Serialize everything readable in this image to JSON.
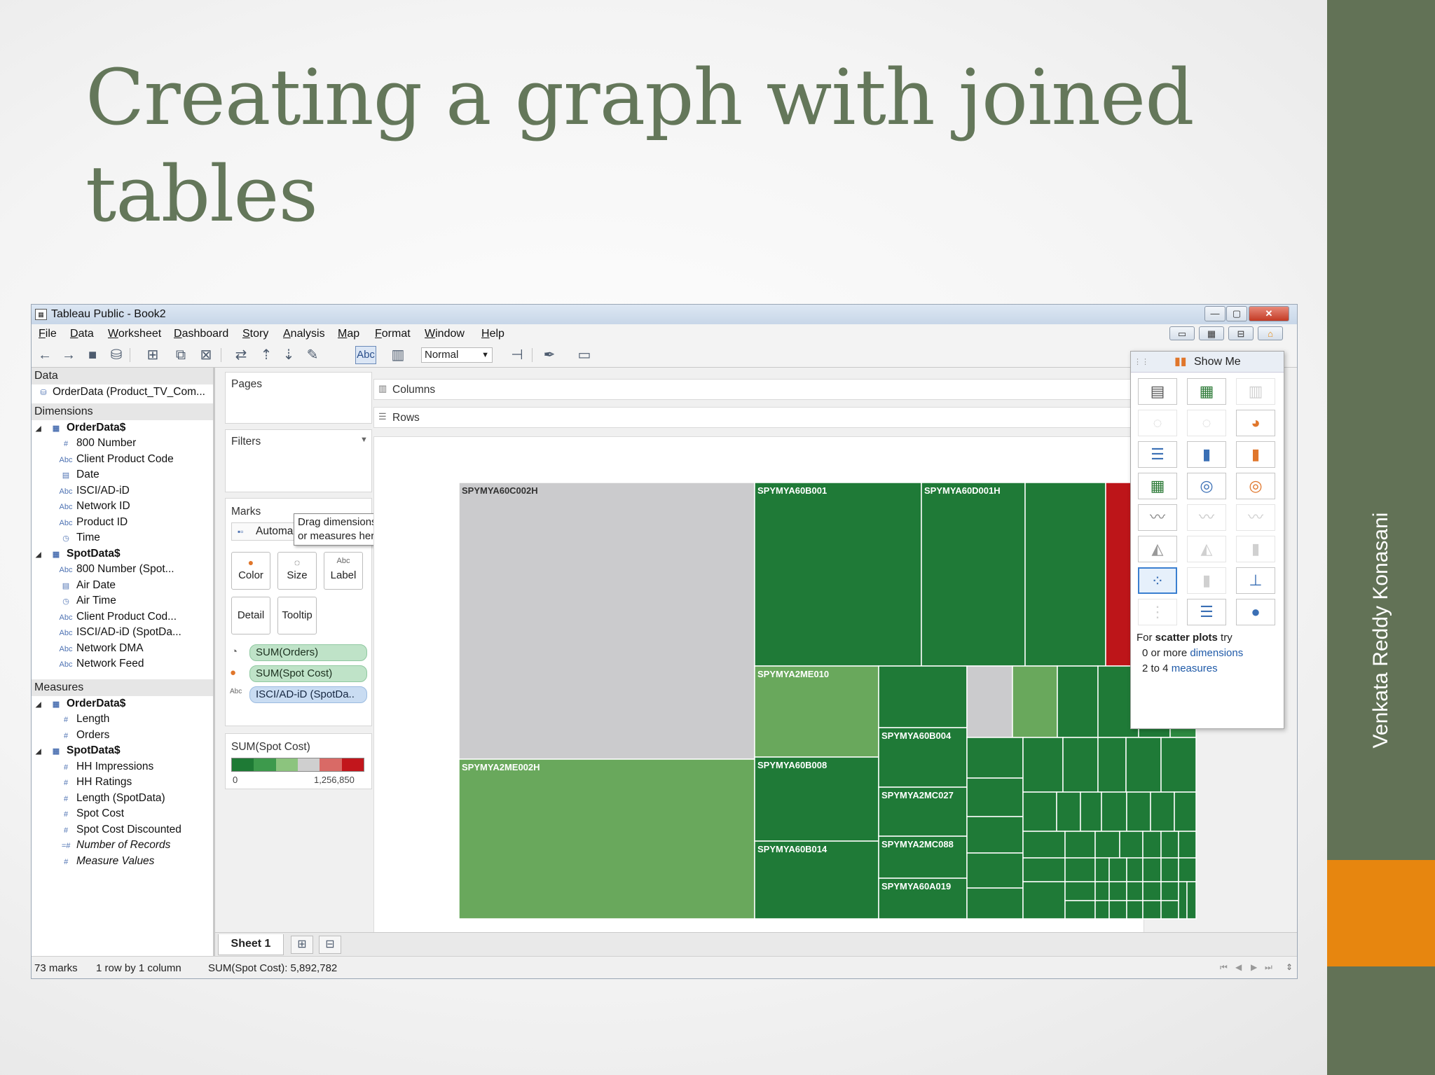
{
  "slide": {
    "title": "Creating a graph with joined tables",
    "author": "Venkata Reddy Konasani"
  },
  "app": {
    "window_title": "Tableau Public - Book2",
    "window_buttons": {
      "minimize": "—",
      "maximize": "▢",
      "close": "✕"
    },
    "menu": [
      "File",
      "Data",
      "Worksheet",
      "Dashboard",
      "Story",
      "Analysis",
      "Map",
      "Format",
      "Window",
      "Help"
    ],
    "toolbar": {
      "show_labels": "Abc",
      "fit": "Normal"
    },
    "data_pane": {
      "header": "Data",
      "datasource": "OrderData (Product_TV_Com...",
      "dimensions_header": "Dimensions",
      "dimensions": [
        {
          "label": "OrderData$",
          "type": "table",
          "group": true
        },
        {
          "label": "800 Number",
          "type": "#"
        },
        {
          "label": "Client Product Code",
          "type": "Abc"
        },
        {
          "label": "Date",
          "type": "date"
        },
        {
          "label": "ISCI/AD-iD",
          "type": "Abc"
        },
        {
          "label": "Network ID",
          "type": "Abc"
        },
        {
          "label": "Product ID",
          "type": "Abc"
        },
        {
          "label": "Time",
          "type": "datetime"
        },
        {
          "label": "SpotData$",
          "type": "table",
          "group": true
        },
        {
          "label": "800 Number (Spot...",
          "type": "Abc"
        },
        {
          "label": "Air Date",
          "type": "date"
        },
        {
          "label": "Air Time",
          "type": "datetime"
        },
        {
          "label": "Client Product Cod...",
          "type": "Abc"
        },
        {
          "label": "ISCI/AD-iD (SpotDa...",
          "type": "Abc"
        },
        {
          "label": "Network DMA",
          "type": "Abc"
        },
        {
          "label": "Network Feed",
          "type": "Abc"
        }
      ],
      "measures_header": "Measures",
      "measures": [
        {
          "label": "OrderData$",
          "type": "table",
          "group": true
        },
        {
          "label": "Length",
          "type": "#"
        },
        {
          "label": "Orders",
          "type": "#"
        },
        {
          "label": "SpotData$",
          "type": "table",
          "group": true
        },
        {
          "label": "HH Impressions",
          "type": "#"
        },
        {
          "label": "HH Ratings",
          "type": "#"
        },
        {
          "label": "Length (SpotData)",
          "type": "#"
        },
        {
          "label": "Spot Cost",
          "type": "#"
        },
        {
          "label": "Spot Cost Discounted",
          "type": "#"
        },
        {
          "label": "Number of Records",
          "type": "=#",
          "italic": true
        },
        {
          "label": "Measure Values",
          "type": "#",
          "italic": true
        }
      ]
    },
    "shelves": {
      "pages": "Pages",
      "filters": "Filters",
      "marks": "Marks",
      "mark_type": "Automa",
      "tooltip_hint_1": "Drag dimensions",
      "tooltip_hint_2": "or measures here.",
      "mark_buttons": {
        "color": "Color",
        "size": "Size",
        "label": "Label",
        "detail": "Detail",
        "tooltip": "Tooltip"
      },
      "pills": [
        "SUM(Orders)",
        "SUM(Spot Cost)",
        "ISCI/AD-iD (SpotDa.."
      ],
      "columns": "Columns",
      "rows": "Rows"
    },
    "legend": {
      "title": "SUM(Spot Cost)",
      "min_label": "0",
      "max_label": "1,256,850",
      "colors": [
        "#1e7a35",
        "#3d9a4c",
        "#8cc47e",
        "#cfcfcf",
        "#d96a66",
        "#c2161c"
      ]
    },
    "showme": {
      "title": "Show Me",
      "hint_line1_a": "For ",
      "hint_line1_b": "scatter plots",
      "hint_line1_c": " try",
      "hint_line2_a": "0 or more ",
      "hint_line2_b": "dimensions",
      "hint_line3_a": "2 to 4 ",
      "hint_line3_b": "measures"
    },
    "sheet_tab": "Sheet 1",
    "status": {
      "marks": "73 marks",
      "layout": "1 row by 1 column",
      "sum": "SUM(Spot Cost): 5,892,782"
    }
  },
  "treemap": {
    "labels": [
      "SPYMYA60C002H",
      "SPYMYA60B001",
      "SPYMYA60D001H",
      "SPYMYA2ME010",
      "SPYMYA60B004",
      "SPYMYA2MC027",
      "SPYMYA2MC088",
      "SPYMYA60A019",
      "SPYMYA2ME002H",
      "SPYMYA60B008",
      "SPYMYA60B014"
    ],
    "colors": {
      "dark_green": "#1f7a37",
      "mid_green": "#2d8b41",
      "light_green": "#69a85c",
      "gray": "#cbcbcd",
      "red": "#bd1519",
      "white": "#ffffff"
    }
  }
}
